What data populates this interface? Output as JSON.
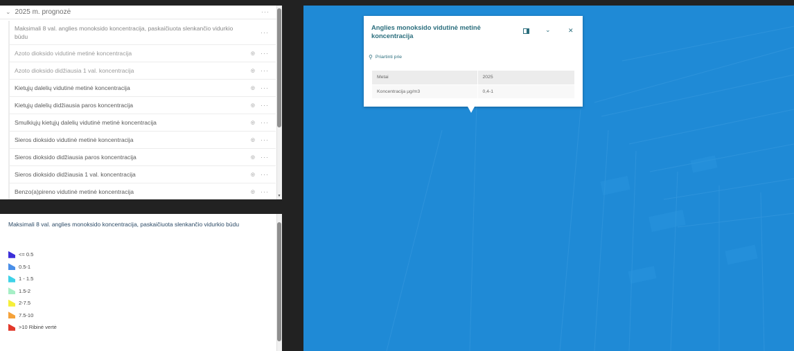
{
  "layer_panel": {
    "group_label": "2025 m. prognozė",
    "layers": [
      {
        "label": "Maksimali 8 val. anglies monoksido koncentracija, paskaičiuota slenkančio vidurkio būdu",
        "faded": true,
        "first": true
      },
      {
        "label": "Azoto dioksido vidutinė metinė koncentracija",
        "faded": true
      },
      {
        "label": "Azoto dioksido didžiausia 1 val. koncentracija",
        "faded": true
      },
      {
        "label": "Kietųjų dalelių vidutinė metinė koncentracija",
        "faded": false
      },
      {
        "label": "Kietųjų dalelių didžiausia paros koncentracija",
        "faded": false
      },
      {
        "label": "Smulkiųjų kietųjų dalelių vidutinė metinė koncentracija",
        "faded": false
      },
      {
        "label": "Sieros dioksido vidutinė metinė koncentracija",
        "faded": false
      },
      {
        "label": "Sieros dioksido didžiausia paros koncentracija",
        "faded": false
      },
      {
        "label": "Sieros dioksido didžiausia 1 val. koncentracija",
        "faded": false
      },
      {
        "label": "Benzo(a)pireno vidutinė metinė koncentracija",
        "faded": false
      }
    ]
  },
  "legend": {
    "title": "Maksimali 8 val. anglies monoksido koncentracija, paskaičiuota slenkančio vidurkio būdu",
    "items": [
      {
        "label": "<= 0.5",
        "color": "#3b2fd9"
      },
      {
        "label": "0.5-1",
        "color": "#4a8fe8"
      },
      {
        "label": "1 - 1.5",
        "color": "#3ed2e8"
      },
      {
        "label": "1.5-2",
        "color": "#a6efc6"
      },
      {
        "label": "2-7.5",
        "color": "#f5ef3a"
      },
      {
        "label": "7.5-10",
        "color": "#f5a23a"
      },
      {
        "label": ">10 Ribinė vertė",
        "color": "#e2382b"
      }
    ]
  },
  "popup": {
    "title": "Anglies monoksido vidutinė metinė koncentracija",
    "zoom_label": "Priartinti prie",
    "rows": [
      {
        "field": "Metai",
        "value": "2025"
      },
      {
        "field": "Koncentracija µg/m3",
        "value": "0,4-1"
      }
    ]
  },
  "colors": {
    "map_blue": "#1f8ad6",
    "popup_accent": "#2b6e7d"
  }
}
